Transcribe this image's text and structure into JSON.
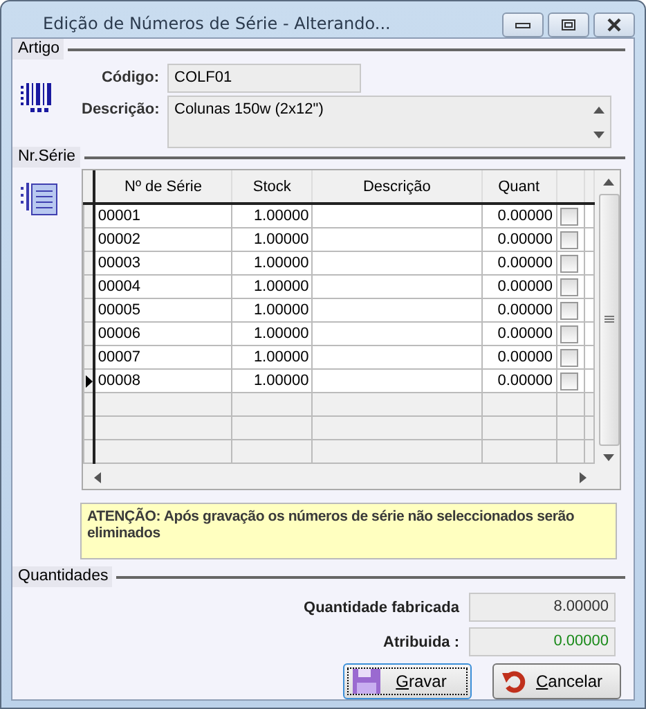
{
  "window": {
    "title": "Edição de Números de Série - Alterando..."
  },
  "artigo": {
    "label": "Artigo",
    "code_label": "Código:",
    "code_value": "COLF01",
    "description_label": "Descrição:",
    "description_value": "Colunas 150w (2x12\")"
  },
  "nr_serie": {
    "label": "Nr.Série",
    "table": {
      "columns": [
        "Nº de Série",
        "Stock",
        "Descrição",
        "Quant"
      ],
      "rows": [
        {
          "serial": "00001",
          "stock": "1.00000",
          "description": "",
          "quant": "0.00000",
          "checked": false,
          "current": false
        },
        {
          "serial": "00002",
          "stock": "1.00000",
          "description": "",
          "quant": "0.00000",
          "checked": false,
          "current": false
        },
        {
          "serial": "00003",
          "stock": "1.00000",
          "description": "",
          "quant": "0.00000",
          "checked": false,
          "current": false
        },
        {
          "serial": "00004",
          "stock": "1.00000",
          "description": "",
          "quant": "0.00000",
          "checked": false,
          "current": false
        },
        {
          "serial": "00005",
          "stock": "1.00000",
          "description": "",
          "quant": "0.00000",
          "checked": false,
          "current": false
        },
        {
          "serial": "00006",
          "stock": "1.00000",
          "description": "",
          "quant": "0.00000",
          "checked": false,
          "current": false
        },
        {
          "serial": "00007",
          "stock": "1.00000",
          "description": "",
          "quant": "0.00000",
          "checked": false,
          "current": false
        },
        {
          "serial": "00008",
          "stock": "1.00000",
          "description": "",
          "quant": "0.00000",
          "checked": false,
          "current": true
        }
      ]
    }
  },
  "note": "ATENÇÃO: Após gravação os números de série não seleccionados serão eliminados",
  "quantidades": {
    "label": "Quantidades",
    "fields": [
      {
        "label": "Quantidade fabricada",
        "value": "8.00000",
        "kind": "normal"
      },
      {
        "label": "Atribuida :",
        "value": "0.00000",
        "kind": "ok"
      }
    ]
  },
  "buttons": [
    {
      "label": "Gravar",
      "kind": "save",
      "focused": true
    },
    {
      "label": "Cancelar",
      "kind": "cancel",
      "focused": false
    }
  ]
}
